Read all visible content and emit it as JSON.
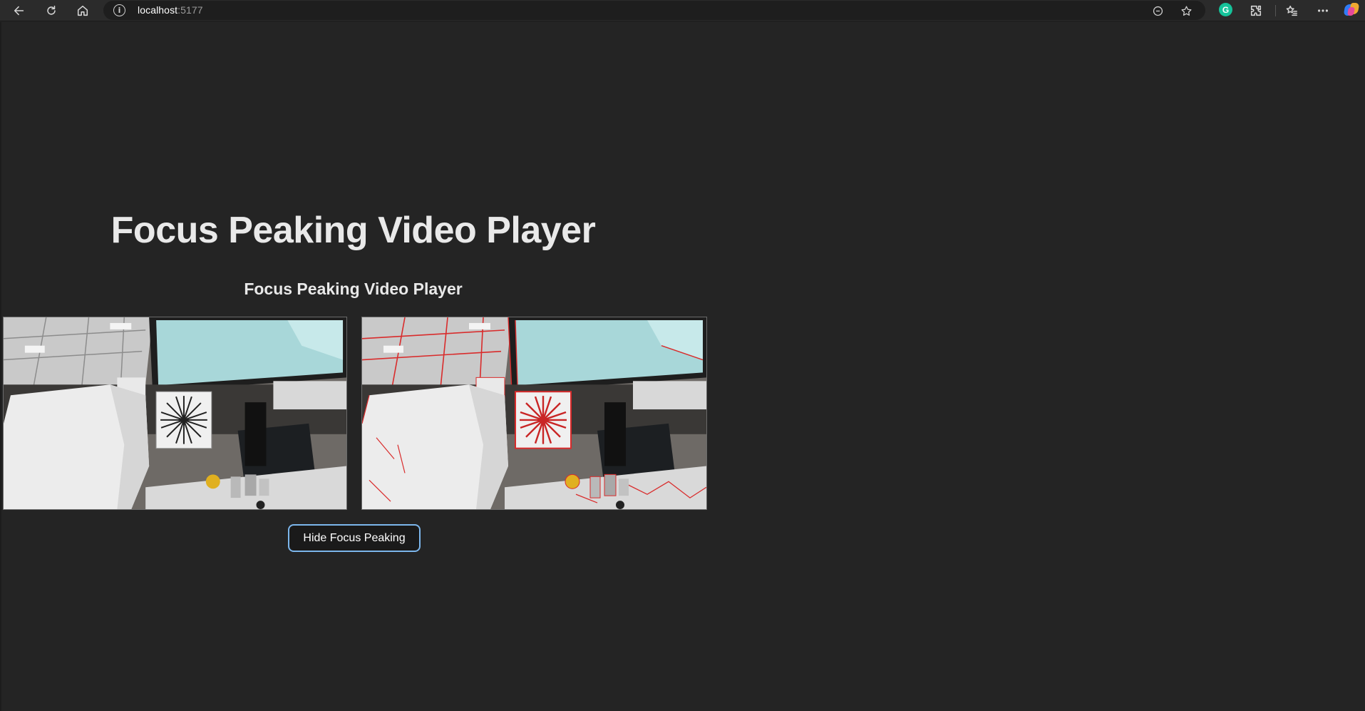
{
  "browser": {
    "url_host": "localhost",
    "url_port": ":5177",
    "info_glyph": "i",
    "extension_letter": "G",
    "icons": [
      "back-icon",
      "reload-icon",
      "home-icon",
      "site-info-icon",
      "reader-mode-icon",
      "favorite-star-icon",
      "grammarly-icon",
      "extensions-icon",
      "favorites-icon",
      "more-menu-icon",
      "copilot-icon"
    ]
  },
  "app": {
    "title": "Focus Peaking Video Player",
    "subtitle": "Focus Peaking Video Player",
    "toggle_button_label": "Hide Focus Peaking"
  },
  "colors": {
    "background": "#242424",
    "button_border": "#7cb6ec",
    "peaking_overlay": "#e0262b"
  }
}
